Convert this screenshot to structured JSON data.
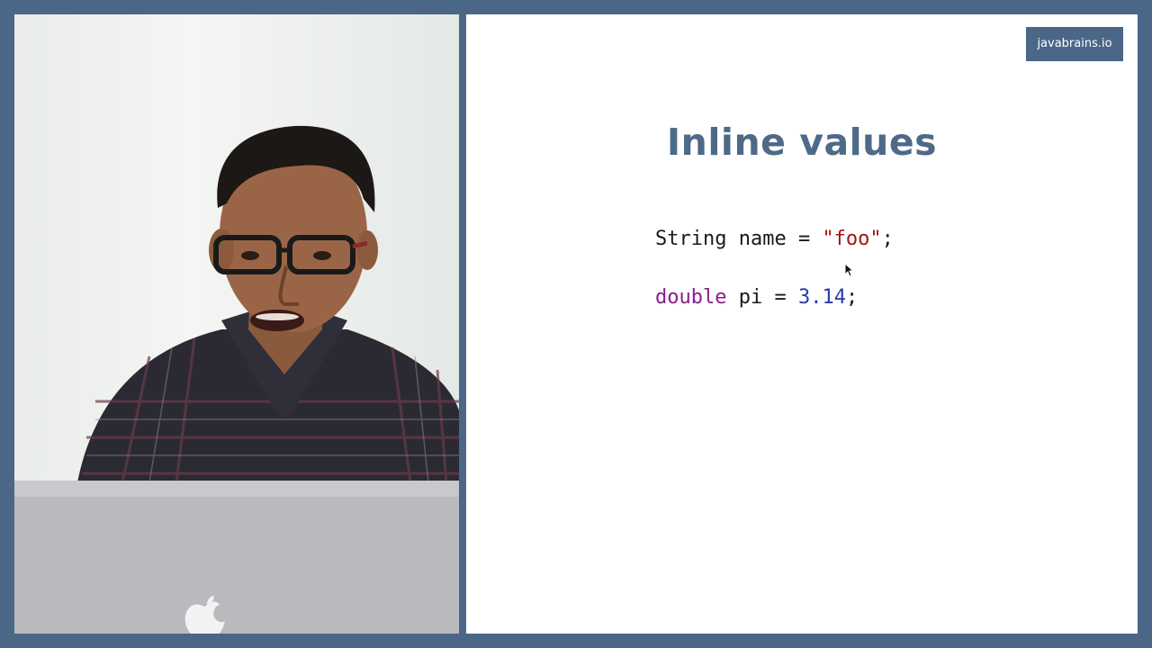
{
  "brand": {
    "label": "javabrains.io"
  },
  "slide": {
    "title": "Inline values",
    "code": [
      {
        "tokens": [
          {
            "text": "String name = ",
            "kind": "plain"
          },
          {
            "text": "\"foo\"",
            "kind": "string"
          },
          {
            "text": ";",
            "kind": "plain"
          }
        ]
      },
      {
        "tokens": [
          {
            "text": "double",
            "kind": "keyword"
          },
          {
            "text": " pi = ",
            "kind": "plain"
          },
          {
            "text": "3.14",
            "kind": "number"
          },
          {
            "text": ";",
            "kind": "plain"
          }
        ]
      }
    ]
  },
  "colors": {
    "frame": "#4a6788",
    "title": "#4d6a87",
    "string": "#a31515",
    "keyword": "#8b1c8b",
    "number": "#2a3aa8"
  },
  "video": {
    "icon": "apple-logo-icon"
  }
}
